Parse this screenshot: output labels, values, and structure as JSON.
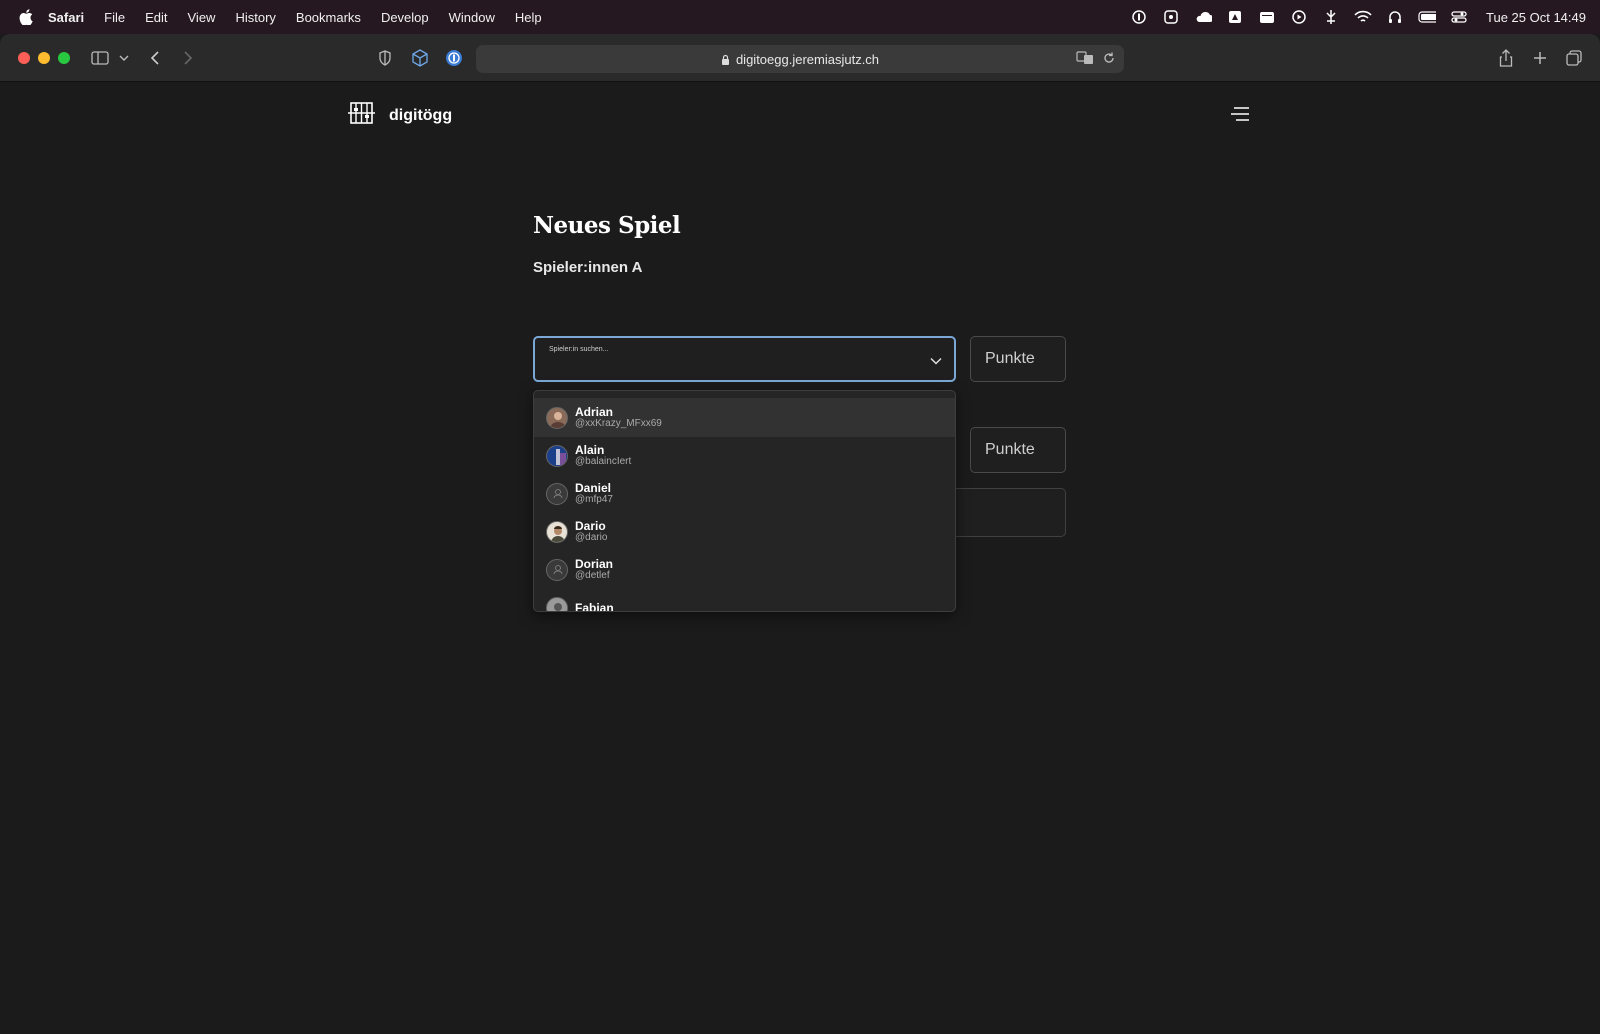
{
  "menubar": {
    "items": [
      "Safari",
      "File",
      "Edit",
      "View",
      "History",
      "Bookmarks",
      "Develop",
      "Window",
      "Help"
    ],
    "clock": "Tue 25 Oct  14:49"
  },
  "browser": {
    "url": "digitoegg.jeremiasjutz.ch"
  },
  "site": {
    "logo_text": "digitögg"
  },
  "form": {
    "title": "Neues Spiel",
    "team_a_label": "Spieler:innen A",
    "select_placeholder": "Spieler:in suchen...",
    "points_placeholder_1": "Punkte",
    "points_placeholder_2": "Punkte"
  },
  "players": [
    {
      "name": "Adrian",
      "handle": "@xxKrazy_MFxx69"
    },
    {
      "name": "Alain",
      "handle": "@balaincIert"
    },
    {
      "name": "Daniel",
      "handle": "@mfp47"
    },
    {
      "name": "Dario",
      "handle": "@dario"
    },
    {
      "name": "Dorian",
      "handle": "@detlef"
    },
    {
      "name": "Fabian",
      "handle": ""
    }
  ]
}
